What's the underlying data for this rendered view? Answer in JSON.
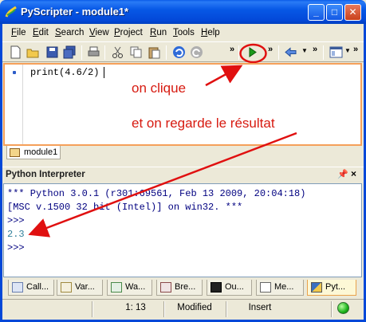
{
  "window": {
    "title": "PyScripter - module1*",
    "minimize_glyph": "_",
    "maximize_glyph": "□",
    "close_glyph": "✕"
  },
  "menu": [
    "File",
    "Edit",
    "Search",
    "View",
    "Project",
    "Run",
    "Tools",
    "Help"
  ],
  "toolbar": {
    "icons": [
      "new-file-icon",
      "open-folder-icon",
      "save-icon",
      "save-all-icon",
      "print-icon",
      "cut-icon",
      "copy-icon",
      "paste-icon",
      "undo-icon",
      "redo-icon",
      "run-icon",
      "back-arrow-icon",
      "layout-icon"
    ],
    "overflow": "»"
  },
  "editor": {
    "code": "print(4.6/2)",
    "annotation_1": "on clique",
    "annotation_2": "et on regarde le résultat",
    "tab_label": "module1"
  },
  "interpreter": {
    "title": "Python Interpreter",
    "pin_glyph": "ꟷ",
    "lines": [
      "*** Python 3.0.1 (r301:69561, Feb 13 2009, 20:04:18)",
      "[MSC v.1500 32 bit (Intel)] on win32. ***",
      ">>>",
      "2.3",
      ">>>"
    ]
  },
  "bottom_tabs": [
    "Call...",
    "Var...",
    "Wa...",
    "Bre...",
    "Ou...",
    "Me...",
    "Pyt..."
  ],
  "status": {
    "position": "1: 13",
    "modified": "Modified",
    "mode": "Insert"
  },
  "colors": {
    "accent_red": "#D71A10",
    "title_blue": "#0348D8",
    "editor_border": "#F5A05A"
  }
}
